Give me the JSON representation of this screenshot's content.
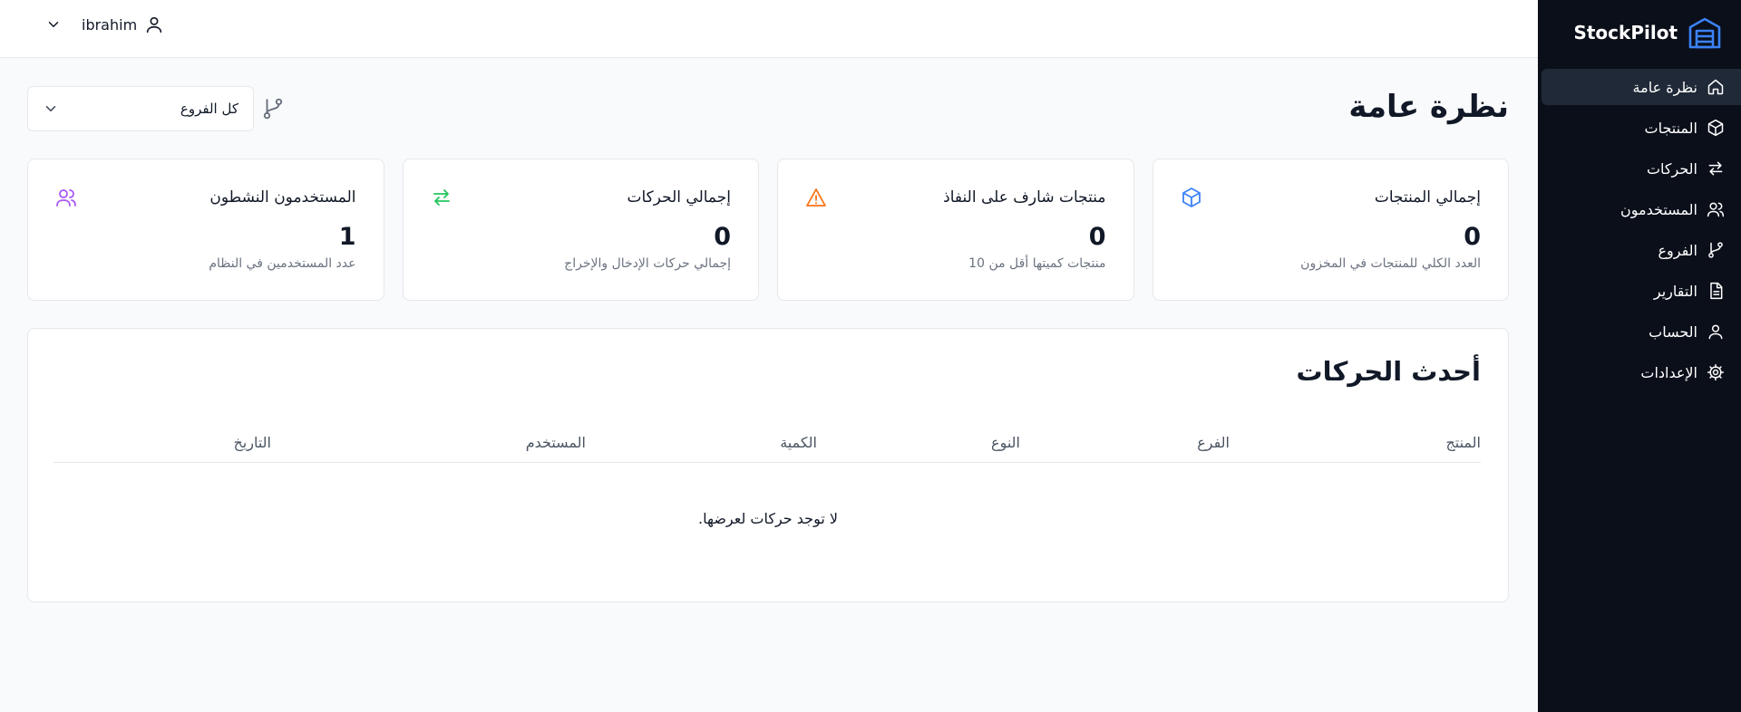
{
  "brand": {
    "name": "StockPilot"
  },
  "user": {
    "name": "ibrahim"
  },
  "sidebar": {
    "items": [
      {
        "label": "نظرة عامة",
        "icon": "home-icon",
        "active": true
      },
      {
        "label": "المنتجات",
        "icon": "box-icon"
      },
      {
        "label": "الحركات",
        "icon": "transfer-icon"
      },
      {
        "label": "المستخدمون",
        "icon": "users-icon"
      },
      {
        "label": "الفروع",
        "icon": "branch-icon"
      },
      {
        "label": "التقارير",
        "icon": "report-icon"
      },
      {
        "label": "الحساب",
        "icon": "user-icon"
      },
      {
        "label": "الإعدادات",
        "icon": "gear-icon"
      }
    ]
  },
  "page": {
    "title": "نظرة عامة"
  },
  "filter": {
    "selected": "كل الفروع"
  },
  "cards": [
    {
      "title": "إجمالي المنتجات",
      "value": "0",
      "desc": "العدد الكلي للمنتجات في المخزون",
      "icon": "box-icon",
      "color": "#3b82f6"
    },
    {
      "title": "منتجات شارف على النفاذ",
      "value": "0",
      "desc": "منتجات كميتها أقل من 10",
      "icon": "warning-icon",
      "color": "#f97316"
    },
    {
      "title": "إجمالي الحركات",
      "value": "0",
      "desc": "إجمالي حركات الإدخال والإخراج",
      "icon": "transfer-icon",
      "color": "#22c55e"
    },
    {
      "title": "المستخدمون النشطون",
      "value": "1",
      "desc": "عدد المستخدمين في النظام",
      "icon": "users-icon",
      "color": "#a855f7"
    }
  ],
  "recent": {
    "title": "أحدث الحركات",
    "columns": [
      "المنتج",
      "الفرع",
      "النوع",
      "الكمية",
      "المستخدم",
      "التاريخ"
    ],
    "empty": "لا توجد حركات لعرضها."
  },
  "colors": {
    "sidebar_bg": "#0b0f1a",
    "active_item_bg": "#1f2937",
    "brand_accent": "#3b82f6"
  }
}
